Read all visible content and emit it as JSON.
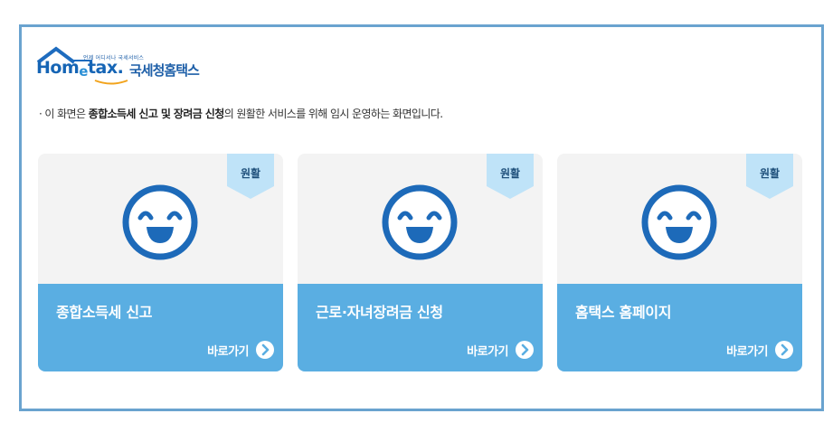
{
  "logo": {
    "tagline": "언제 어디서나 국세서비스",
    "brand_prefix": "Hom",
    "brand_e": "e",
    "brand_suffix": "tax.",
    "korean_name": "국세청홈택스"
  },
  "notice": {
    "bullet": "·",
    "prefix": " 이 화면은 ",
    "service1": "종합소득세 신고",
    "and": " 및 ",
    "service2": "장려금 신청",
    "suffix": "의 원활한 서비스를 위해 임시 운영하는 화면입니다."
  },
  "cards": [
    {
      "title": "종합소득세 신고",
      "status": "원활",
      "link_label": "바로가기"
    },
    {
      "title": "근로·자녀장려금 신청",
      "status": "원활",
      "link_label": "바로가기"
    },
    {
      "title": "홈택스 홈페이지",
      "status": "원활",
      "link_label": "바로가기"
    }
  ],
  "colors": {
    "frame_border": "#6aa3cf",
    "card_top": "#f3f3f3",
    "card_bottom": "#5aaee2",
    "badge": "#bfe3f8",
    "face": "#1d6ab9"
  },
  "icons": {
    "status_face": "smiley-face-icon",
    "goto": "chevron-right-circle-icon"
  }
}
